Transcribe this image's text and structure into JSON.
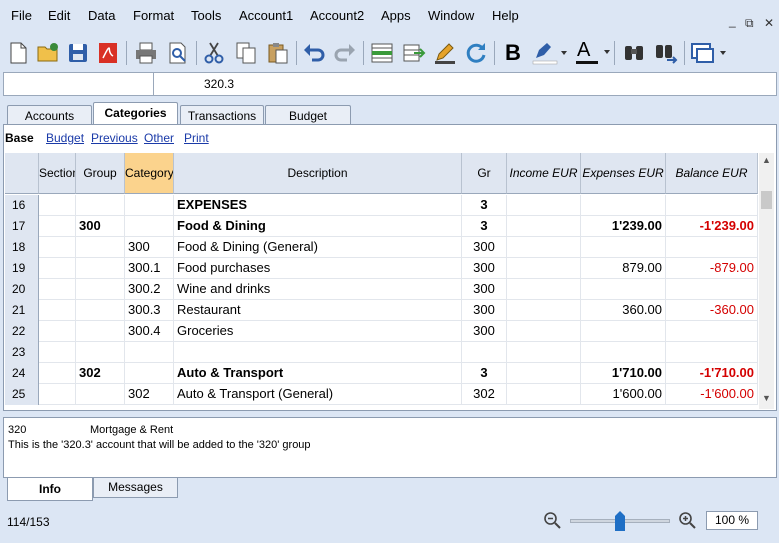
{
  "menu": [
    "File",
    "Edit",
    "Data",
    "Format",
    "Tools",
    "Account1",
    "Account2",
    "Apps",
    "Window",
    "Help"
  ],
  "window_controls": {
    "minimize": "_",
    "restore": "⧉",
    "close": "✕"
  },
  "toolbar_icons": [
    "new-file-icon",
    "open-folder-icon",
    "save-icon",
    "pdf-icon",
    "print-icon",
    "print-preview-icon",
    "cut-icon",
    "copy-icon",
    "paste-icon",
    "undo-icon",
    "redo-icon",
    "insert-row-icon",
    "move-row-icon",
    "edit-icon",
    "refresh-icon",
    "bold-icon",
    "highlight-color-icon",
    "font-color-icon",
    "find-icon",
    "find-next-icon",
    "window-icon"
  ],
  "toolbar_text": {
    "bold": "B",
    "font_color": "A"
  },
  "formula_bar": {
    "value": "320.3"
  },
  "tabs": [
    "Accounts",
    "Categories",
    "Transactions",
    "Budget"
  ],
  "active_tab": "Categories",
  "views": {
    "current": "Base",
    "links": [
      "Budget",
      "Previous",
      "Other",
      "Print"
    ]
  },
  "table": {
    "headers": {
      "section": "Section",
      "group": "Group",
      "category": "Category",
      "description": "Description",
      "gr": "Gr",
      "income": "Income EUR",
      "expenses": "Expenses EUR",
      "balance": "Balance EUR"
    },
    "rows": [
      {
        "num": "16",
        "section": "",
        "group": "",
        "category": "",
        "description": "EXPENSES",
        "gr": "3",
        "income": "",
        "expenses": "",
        "balance": "",
        "bold": true
      },
      {
        "num": "17",
        "section": "",
        "group": "300",
        "category": "",
        "description": "Food & Dining",
        "gr": "3",
        "income": "",
        "expenses": "1'239.00",
        "balance": "-1'239.00",
        "bold": true
      },
      {
        "num": "18",
        "section": "",
        "group": "",
        "category": "300",
        "description": "Food & Dining (General)",
        "gr": "300",
        "income": "",
        "expenses": "",
        "balance": "",
        "bold": false
      },
      {
        "num": "19",
        "section": "",
        "group": "",
        "category": "300.1",
        "description": "Food purchases",
        "gr": "300",
        "income": "",
        "expenses": "879.00",
        "balance": "-879.00",
        "bold": false
      },
      {
        "num": "20",
        "section": "",
        "group": "",
        "category": "300.2",
        "description": "Wine and drinks",
        "gr": "300",
        "income": "",
        "expenses": "",
        "balance": "",
        "bold": false
      },
      {
        "num": "21",
        "section": "",
        "group": "",
        "category": "300.3",
        "description": "Restaurant",
        "gr": "300",
        "income": "",
        "expenses": "360.00",
        "balance": "-360.00",
        "bold": false
      },
      {
        "num": "22",
        "section": "",
        "group": "",
        "category": "300.4",
        "description": "Groceries",
        "gr": "300",
        "income": "",
        "expenses": "",
        "balance": "",
        "bold": false
      },
      {
        "num": "23",
        "section": "",
        "group": "",
        "category": "",
        "description": "",
        "gr": "",
        "income": "",
        "expenses": "",
        "balance": "",
        "bold": false
      },
      {
        "num": "24",
        "section": "",
        "group": "302",
        "category": "",
        "description": "Auto & Transport",
        "gr": "3",
        "income": "",
        "expenses": "1'710.00",
        "balance": "-1'710.00",
        "bold": true
      },
      {
        "num": "25",
        "section": "",
        "group": "",
        "category": "302",
        "description": "Auto & Transport (General)",
        "gr": "302",
        "income": "",
        "expenses": "1'600.00",
        "balance": "-1'600.00",
        "bold": false
      }
    ]
  },
  "info": {
    "account": "320",
    "account_desc": "Mortgage & Rent",
    "message": "This is the '320.3' account that will be added to the '320' group"
  },
  "bottom_tabs": [
    "Info",
    "Messages"
  ],
  "status": {
    "position": "114/153",
    "zoom": "100 %",
    "zoom_percent": 100
  },
  "colors": {
    "negative": "#d40000",
    "selected_header": "#fbd38d",
    "link": "#1a3aa8"
  }
}
